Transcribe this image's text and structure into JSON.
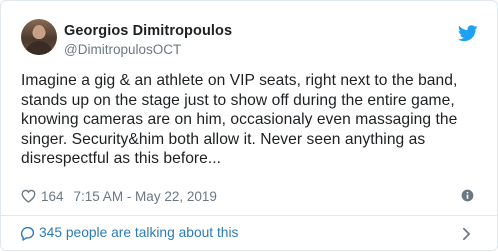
{
  "author": {
    "name": "Georgios Dimitropoulos",
    "handle": "@DimitropulosOCT",
    "avatar_icon": "profile-photo"
  },
  "tweet": {
    "lines": [
      "Imagine a gig & an athlete on VIP seats, right next to the band,",
      "stands up on the stage just to show off during the entire game,",
      "knowing cameras are on him, occasionaly even massaging the",
      "singer. Security&him both allow it. Never seen anything as",
      "disrespectful as this before..."
    ]
  },
  "meta": {
    "likes": "164",
    "timestamp": "7:15 AM - May 22, 2019"
  },
  "conversation": {
    "label": "345 people are talking about this"
  },
  "icons": {
    "brand": "twitter-bird-icon",
    "like": "heart-icon",
    "info": "info-icon",
    "conversation": "speech-bubble-icon",
    "navigate": "chevron-right-icon"
  },
  "colors": {
    "brand_blue": "#1da1f2",
    "link_blue": "#2b7bb9",
    "text_primary": "#1c2022",
    "text_secondary": "#697882",
    "border": "#e1e8ed"
  }
}
